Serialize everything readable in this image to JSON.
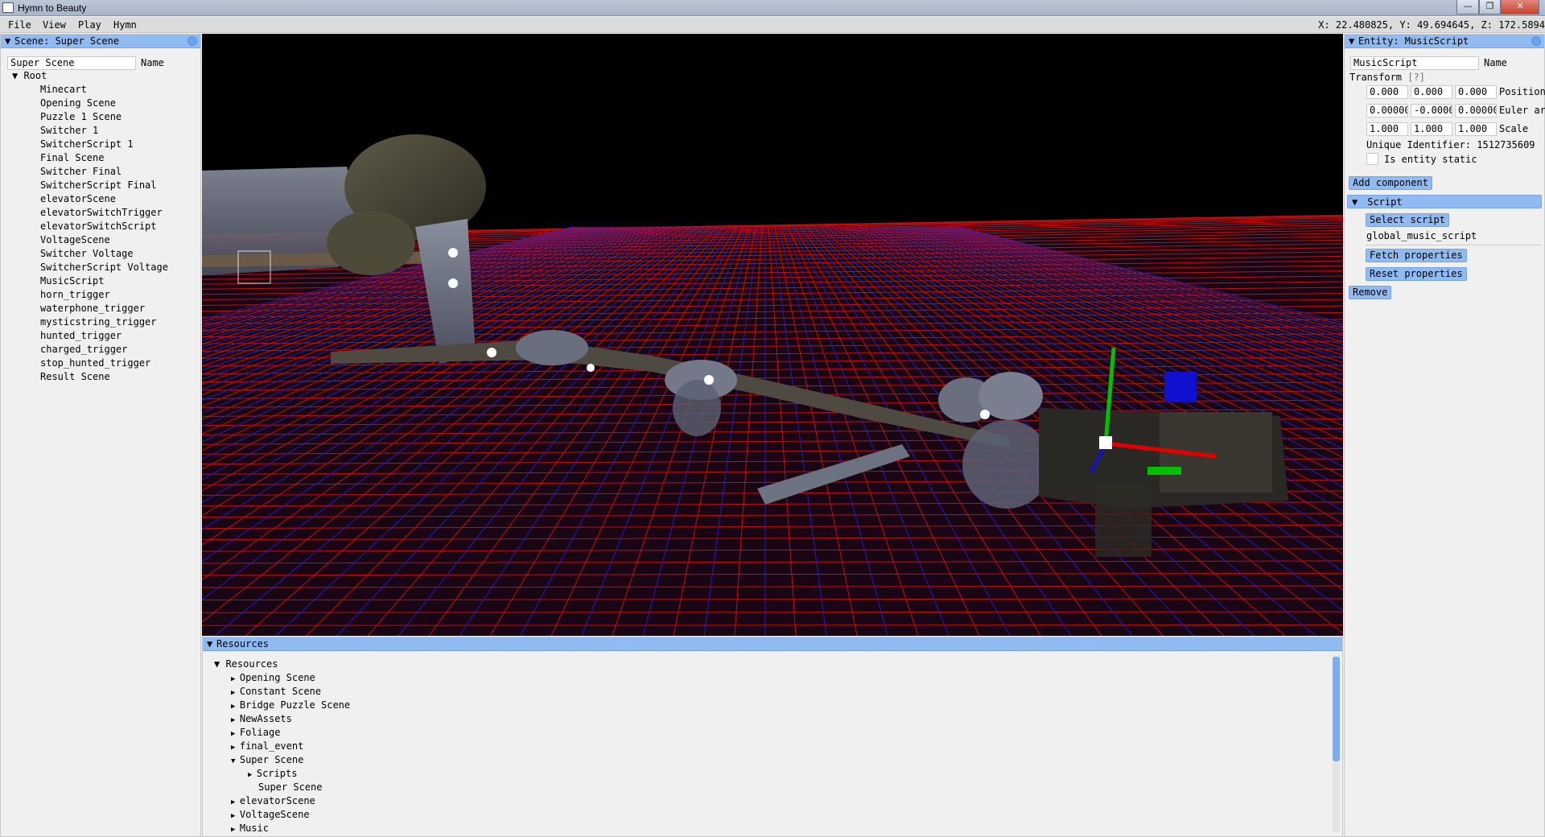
{
  "window": {
    "title": "Hymn to Beauty",
    "minimize": "—",
    "maximize": "❐",
    "close": "✕"
  },
  "menu": {
    "items": [
      "File",
      "View",
      "Play",
      "Hymn"
    ],
    "coordinates": "X: 22.480825, Y: 49.694645, Z: 172.5894"
  },
  "scene_panel": {
    "header": "Scene: Super Scene",
    "name_value": "Super Scene",
    "name_label": "Name",
    "root": "Root",
    "entities": [
      "Minecart",
      "Opening Scene",
      "Puzzle 1 Scene",
      "Switcher 1",
      "SwitcherScript 1",
      "Final Scene",
      "Switcher Final",
      "SwitcherScript Final",
      "elevatorScene",
      "elevatorSwitchTrigger",
      "elevatorSwitchScript",
      "VoltageScene",
      "Switcher Voltage",
      "SwitcherScript Voltage",
      "MusicScript",
      "horn_trigger",
      "waterphone_trigger",
      "mysticstring_trigger",
      "hunted_trigger",
      "charged_trigger",
      "stop_hunted_trigger",
      "Result Scene"
    ]
  },
  "entity_panel": {
    "header": "Entity: MusicScript",
    "name_value": "MusicScript",
    "name_label": "Name",
    "transform_label": "Transform",
    "transform_help": "[?]",
    "position": [
      "0.000",
      "0.000",
      "0.000"
    ],
    "position_label": "Position",
    "euler": [
      "0.00000",
      "-0.0000",
      "0.00000"
    ],
    "euler_label": "Euler ar",
    "scale": [
      "1.000",
      "1.000",
      "1.000"
    ],
    "scale_label": "Scale",
    "unique_id": "Unique Identifier: 1512735609",
    "is_static_label": "Is entity static",
    "add_component": "Add component",
    "script_header": "Script",
    "select_script": "Select script",
    "script_name": "global_music_script",
    "fetch_properties": "Fetch properties",
    "reset_properties": "Reset properties",
    "remove": "Remove"
  },
  "resources_panel": {
    "header": "Resources",
    "root": "Resources",
    "items": [
      {
        "label": "Opening Scene",
        "expanded": false
      },
      {
        "label": "Constant Scene",
        "expanded": false
      },
      {
        "label": "Bridge Puzzle Scene",
        "expanded": false
      },
      {
        "label": "NewAssets",
        "expanded": false
      },
      {
        "label": "Foliage",
        "expanded": false
      },
      {
        "label": "final_event",
        "expanded": false
      },
      {
        "label": "Super Scene",
        "expanded": true
      },
      {
        "label": "Scripts",
        "expanded": false
      },
      {
        "label": "Super Scene",
        "expanded": null
      },
      {
        "label": "elevatorScene",
        "expanded": false
      },
      {
        "label": "VoltageScene",
        "expanded": false
      },
      {
        "label": "Music",
        "expanded": false
      }
    ]
  },
  "colors": {
    "header_blue": "#8fbaf2",
    "grid_red": "#c01010",
    "grid_blue": "#2020c0",
    "gizmo_x": "#e00000",
    "gizmo_y": "#00c000",
    "gizmo_z": "#1010d0"
  }
}
